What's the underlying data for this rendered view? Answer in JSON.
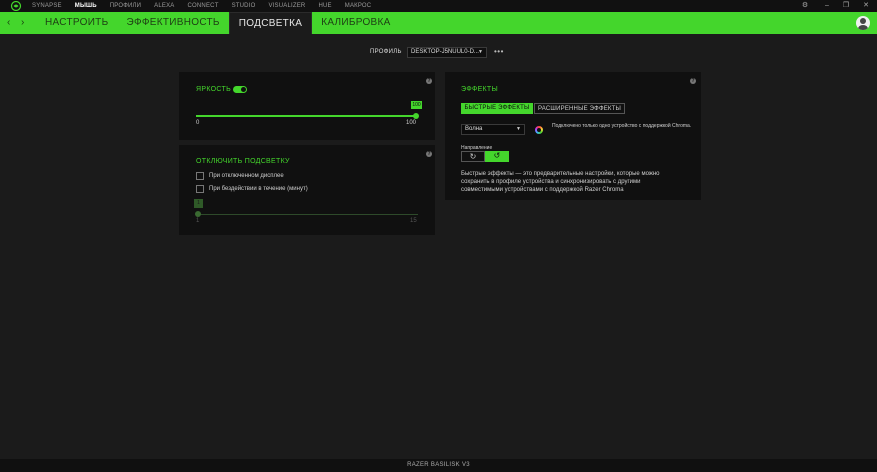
{
  "top_nav": {
    "items": [
      {
        "label": "SYNAPSE",
        "active": false
      },
      {
        "label": "МЫШЬ",
        "active": true
      },
      {
        "label": "ПРОФИЛИ",
        "active": false
      },
      {
        "label": "ALEXA",
        "active": false
      },
      {
        "label": "CONNECT",
        "active": false
      },
      {
        "label": "STUDIO",
        "active": false
      },
      {
        "label": "VISUALIZER",
        "active": false
      },
      {
        "label": "HUE",
        "active": false
      },
      {
        "label": "МАКРОС",
        "active": false
      }
    ],
    "settings_glyph": "⚙",
    "minimize_glyph": "–",
    "maximize_glyph": "❐",
    "close_glyph": "✕"
  },
  "sub_nav": {
    "back_glyph": "‹",
    "forward_glyph": "›",
    "tabs": [
      {
        "label": "НАСТРОИТЬ",
        "active": false
      },
      {
        "label": "ЭФФЕКТИВНОСТЬ",
        "active": false
      },
      {
        "label": "ПОДСВЕТКА",
        "active": true
      },
      {
        "label": "КАЛИБРОВКА",
        "active": false
      }
    ]
  },
  "profile": {
    "label": "ПРОФИЛЬ",
    "value": "DESKTOP-J5NUUL0-D...",
    "caret": "▼",
    "more": "•••"
  },
  "brightness": {
    "title": "ЯРКОСТЬ",
    "enabled": true,
    "value": "100",
    "min": "0",
    "max": "100",
    "fraction": 1.0,
    "info": "?"
  },
  "lighting_off": {
    "title": "ОТКЛЮЧИТЬ ПОДСВЕТКУ",
    "info": "?",
    "option_display": "При отключенном дисплее",
    "option_idle": "При бездействии в течение (минут)",
    "idle_value": "1",
    "idle_min": "1",
    "idle_max": "15",
    "idle_fraction": 0.0
  },
  "effects": {
    "title": "ЭФФЕКТЫ",
    "info": "?",
    "tab_quick": "БЫСТРЫЕ ЭФФЕКТЫ",
    "tab_advanced": "РАСШИРЕННЫЕ ЭФФЕКТЫ",
    "selected_effect": "Волна",
    "caret": "▼",
    "chroma_note": "Подключено только одно устройство с поддержкой Chroma.",
    "direction_label": "Направление",
    "dir_left_glyph": "↻",
    "dir_right_glyph": "↺",
    "description": "Быстрые эффекты — это предварительные настройки, которые можно сохранить в профиле устройства и синхронизировать с другими совместимыми устройствами с поддержкой Razer Chroma"
  },
  "footer": {
    "device": "RAZER BASILISK V3"
  },
  "colors": {
    "accent": "#44d62c",
    "panel": "#101010",
    "background": "#1b1b1b"
  }
}
